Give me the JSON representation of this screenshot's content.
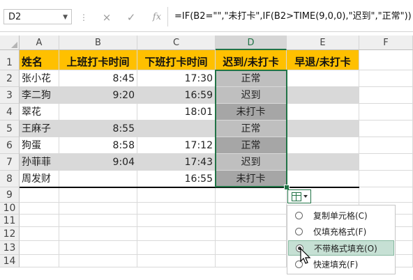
{
  "name_box": "D2",
  "formula_bar": {
    "cancel_icon": "×",
    "enter_icon": "✓",
    "fx_label": "fx",
    "formula": "=IF(B2=\"\",\"未打卡\",IF(B2>TIME(9,0,0),\"迟到\",\"正常\"))"
  },
  "columns": [
    "A",
    "B",
    "C",
    "D",
    "E",
    "F"
  ],
  "rows": [
    "1",
    "2",
    "3",
    "4",
    "5",
    "6",
    "7",
    "8",
    "9",
    "10",
    "11",
    "12",
    "13",
    "14"
  ],
  "headers": [
    "姓名",
    "上班打卡时间",
    "下班打卡时间",
    "迟到/未打卡",
    "早退/未打卡"
  ],
  "table": [
    {
      "name": "张小花",
      "in": "8:45",
      "out": "17:30",
      "status": "正常"
    },
    {
      "name": "李二狗",
      "in": "9:20",
      "out": "16:59",
      "status": "迟到"
    },
    {
      "name": "翠花",
      "in": "",
      "out": "18:01",
      "status": "未打卡"
    },
    {
      "name": "王麻子",
      "in": "8:55",
      "out": "",
      "status": "正常"
    },
    {
      "name": "狗蛋",
      "in": "8:58",
      "out": "17:12",
      "status": "正常"
    },
    {
      "name": "孙菲菲",
      "in": "9:04",
      "out": "17:43",
      "status": "迟到"
    },
    {
      "name": "周发财",
      "in": "",
      "out": "16:55",
      "status": "未打卡"
    }
  ],
  "autofill_menu": {
    "items": [
      {
        "label": "复制单元格(C)",
        "selected": false
      },
      {
        "label": "仅填充格式(F)",
        "selected": false
      },
      {
        "label": "不带格式填充(O)",
        "selected": true
      },
      {
        "label": "快速填充(F)",
        "selected": false
      }
    ]
  },
  "colors": {
    "header_fill": "#ffc000",
    "selection": "#217346",
    "stripe": "#d9d9d9"
  }
}
